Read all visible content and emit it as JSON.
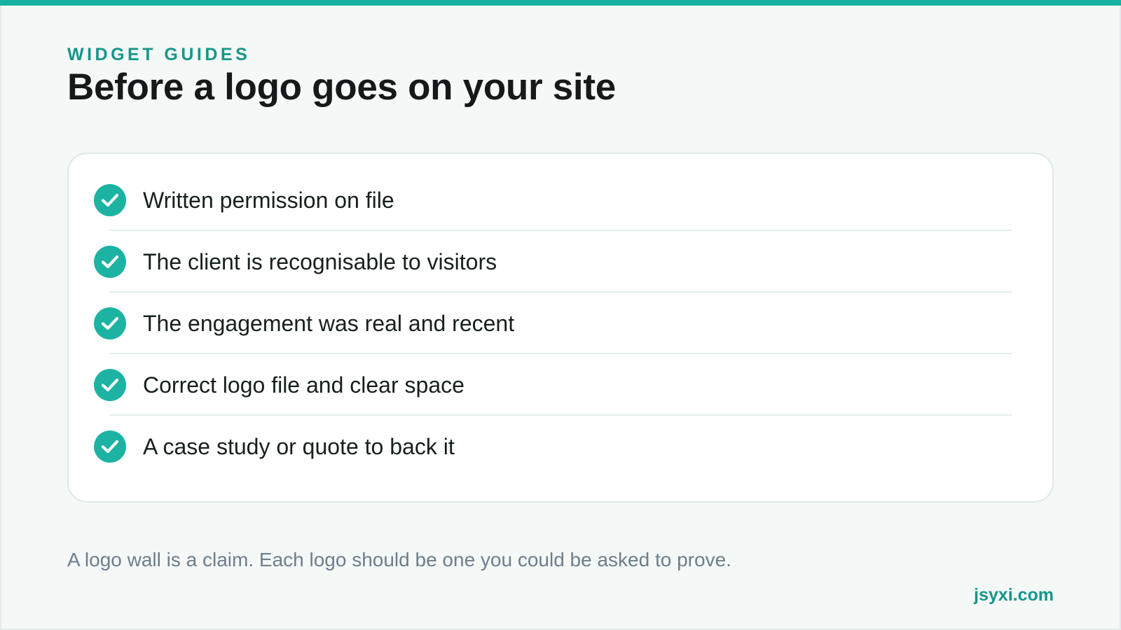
{
  "header": {
    "eyebrow": "WIDGET GUIDES",
    "title": "Before a logo goes on your site"
  },
  "checklist": {
    "icon": "check-circle-icon",
    "accent_color": "#1cb3a3",
    "items": [
      {
        "label": "Written permission on file",
        "checked": true
      },
      {
        "label": "The client is recognisable to visitors",
        "checked": true
      },
      {
        "label": "The engagement was real and recent",
        "checked": true
      },
      {
        "label": "Correct logo file and clear space",
        "checked": true
      },
      {
        "label": "A case study or quote to back it",
        "checked": true
      }
    ]
  },
  "footer": {
    "note": "A logo wall is a claim. Each logo should be one you could be asked to prove.",
    "brand": "jsyxi.com"
  },
  "colors": {
    "accent": "#17b3a2",
    "brand_text": "#16968a",
    "background": "#f4f8f7"
  }
}
